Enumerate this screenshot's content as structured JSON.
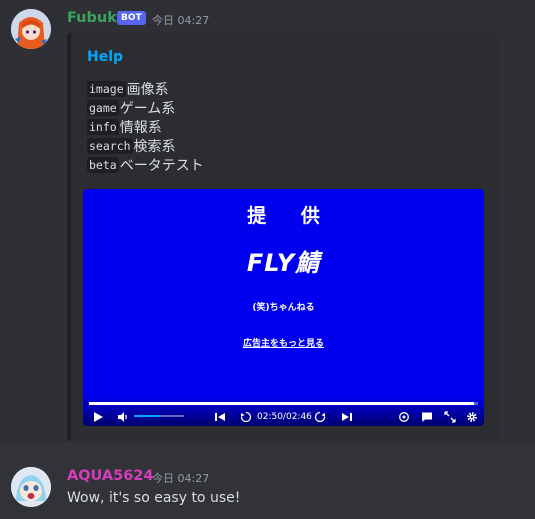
{
  "message1": {
    "username": "Fubuki",
    "bot_tag": "BOT",
    "timestamp": "今日 04:27",
    "embed": {
      "title": "Help",
      "commands": [
        {
          "cmd": "image",
          "desc": "画像系"
        },
        {
          "cmd": "game",
          "desc": "ゲーム系"
        },
        {
          "cmd": "info",
          "desc": "情報系"
        },
        {
          "cmd": "search",
          "desc": "検索系"
        },
        {
          "cmd": "beta",
          "desc": "ベータテスト"
        }
      ],
      "video": {
        "line1": "提 供",
        "logo": "FLY鯖",
        "sponsor": "(笑)ちゃんねる",
        "more_link": "広告主をもっと見る",
        "time": "02:50/02:46",
        "progress": 0.99,
        "volume": 0.5
      }
    }
  },
  "message2": {
    "username": "AQUA5624",
    "timestamp": "今日 04:27",
    "text": "Wow, it's so easy to use!"
  },
  "colors": {
    "bot_name": "#3ba55d",
    "user_name": "#d63dbb",
    "embed_title": "#00a8fc",
    "video_bg": "#0000ee"
  }
}
